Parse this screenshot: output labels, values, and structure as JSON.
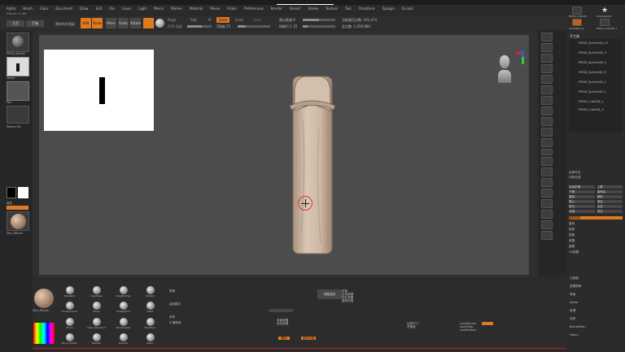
{
  "app": {
    "title_line": "ZBrush 4.2R6",
    "menu": [
      "Alpha",
      "Brush",
      "Color",
      "Document",
      "Draw",
      "Edit",
      "File",
      "Layer",
      "Light",
      "Macro",
      "Marker",
      "Material",
      "Movie",
      "Picker",
      "Preferences",
      "Render",
      "Stencil",
      "Stroke",
      "Texture",
      "Tool",
      "Transform",
      "Zplugin",
      "Zscript"
    ],
    "top_right_label": "ZBrush"
  },
  "shelf": {
    "left_btn1": "主页",
    "left_btn2": "灯箱",
    "quicksave": "预览布尔渲染",
    "modes": [
      {
        "label": "Edit",
        "active": true
      },
      {
        "label": "Draw",
        "active": true
      },
      {
        "label": "Move",
        "active": false
      },
      {
        "label": "Scale",
        "active": false
      },
      {
        "label": "Rotate",
        "active": false
      }
    ],
    "mrgb": "Mrgb",
    "rgb": "Rgb",
    "m": "M",
    "zadd": "Zadd",
    "zsub": "Zsub",
    "zcut": "Zcut",
    "focal_shift_label": "焦点衰减 0",
    "draw_size_label": "绘制尺寸 25",
    "rgb_intensity_label": "RGB 强度",
    "z_intensity_label": "Z强度 25",
    "active_points": "当前激活点数: 101,474",
    "total_points": "总点数: 1,459,680",
    "z_intensity_value": 0.25,
    "draw_size_value": 0.15,
    "focal_shift_value": 0.5,
    "rgb_intensity_value": 0.6
  },
  "left_tray": {
    "items": [
      "PM3D_SkinXt5",
      "Stamp",
      "Pen",
      "Texture Off"
    ],
    "color_label": "渐变",
    "material_label": "Skin_ZBrush"
  },
  "right_shelf": {
    "buttons": [
      "Bpr",
      "Persp",
      "Floor",
      "Local",
      "L.Sym",
      "Frame",
      "Move",
      "Scale",
      "Rotate",
      "PolyF",
      "Transp",
      "Solo",
      "Ghost",
      "Xpose"
    ]
  },
  "subtool": {
    "top": [
      "PM3D_Cube3D",
      "PolyMesh3D",
      "SimpleBrush",
      "PM3D_Cube3D_1"
    ],
    "header": "子工具",
    "list": [
      "PM3D_Sphere3D_22",
      "PM3D_Sphere3D_3",
      "PM3D_Sphere3D_4",
      "PM3D_Sphere3D_5",
      "PM3D_Sphere3D_2",
      "PM3D_Sphere3D_1",
      "PM3D_Cube3D_1",
      "PM3D_Cube3D_3"
    ],
    "controls": [
      "全部可见",
      "列表全部",
      "自动折叠",
      "上移",
      "下移",
      "重命名",
      "复制",
      "删除",
      "插入",
      "追加",
      "拆分",
      "合并",
      "分组",
      "拆分",
      "重新投影"
    ],
    "sections": [
      "重构",
      "投射",
      "提取",
      "遮罩",
      "重建",
      "UV贴图"
    ]
  },
  "bottom": {
    "brushes": [
      "Standard",
      "ClayTubes",
      "ClayBuildup",
      "hPolish",
      "TrimDynamic",
      "Move",
      "SnakeHook",
      "Inflat",
      "Pinch",
      "Dam_Standard",
      "SkinShade4",
      "PolyDeco",
      "Move_Elastic",
      "MatCap",
      "Smooth",
      "Basic"
    ],
    "material_label": "Skin_ZBrush",
    "center_labels": [
      "笔刷",
      "曲线模式",
      "采样",
      "平滑笔刷",
      "调整曲线",
      "重新加载"
    ],
    "mid_labels": [
      "背面遮罩",
      "前后遮罩",
      "雕刻",
      "画布深度",
      "双面",
      "自动遮罩",
      "拓扑遮罩"
    ],
    "right_labels": [
      "拉伸尺寸",
      "灵敏度",
      "LazyMouse",
      "LazyStep",
      "LazyRadius"
    ],
    "far_right": [
      "凸起值",
      "遮罩笔刷",
      "笔画",
      "Alpha",
      "纹理",
      "材质",
      "BlendMesh",
      "Fibers"
    ]
  },
  "canvas": {
    "bg": "#4c4c4c",
    "border_color": "#5c5c5c"
  }
}
